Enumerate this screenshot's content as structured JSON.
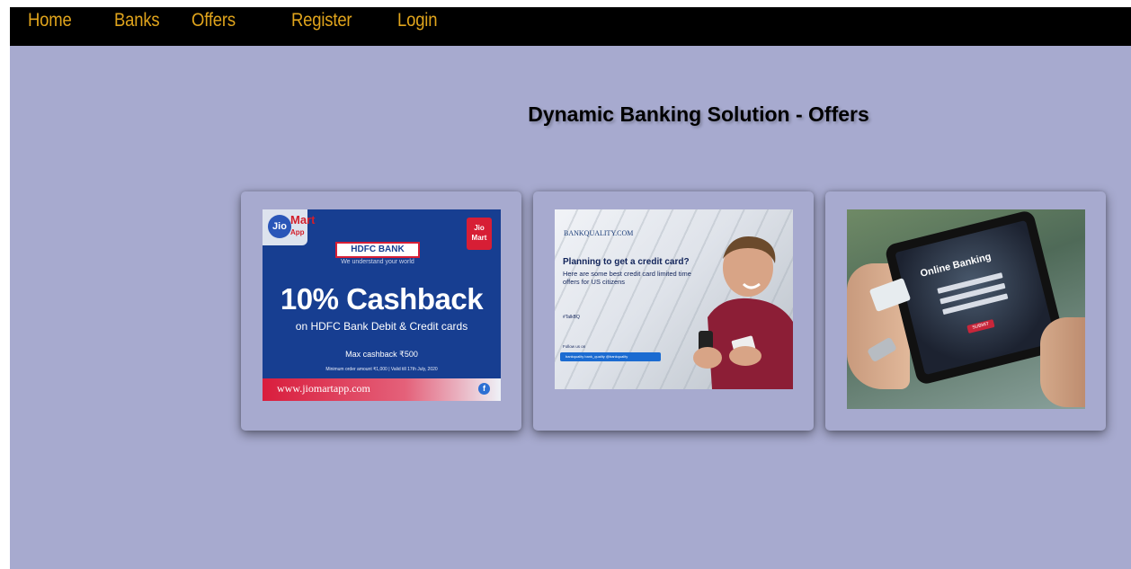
{
  "nav": {
    "items": [
      "Home",
      "Banks",
      "Offers",
      "Register",
      "Login"
    ]
  },
  "page": {
    "title": "Dynamic Banking Solution - Offers"
  },
  "offers": [
    {
      "jio_logo": "Jio",
      "jio_mart": "Mart",
      "jio_app": "App",
      "badge_line1": "Jio",
      "badge_line2": "Mart",
      "bank": "HDFC BANK",
      "tagline": "We understand your world",
      "headline": "10% Cashback",
      "sub": "on HDFC Bank Debit & Credit cards",
      "max": "Max cashback ₹500",
      "minimum": "Minimum order amount ₹1,000 | Valid till 17th July, 2020",
      "url": "www.jiomartapp.com"
    },
    {
      "brand": "BANKQUALITY.COM",
      "headline": "Planning to get a credit card?",
      "body": "Here are some best credit card limited time offers for US citizens",
      "hashtag": "#TalkBQ",
      "follow": "Follow us on",
      "social": "bankquality  bank_quality  @bankquality"
    },
    {
      "screen_title": "Online Banking",
      "button": "SUBMIT"
    }
  ],
  "colors": {
    "nav_bg": "#000000",
    "nav_link": "#e0a41c",
    "page_bg": "#a7aacf"
  }
}
